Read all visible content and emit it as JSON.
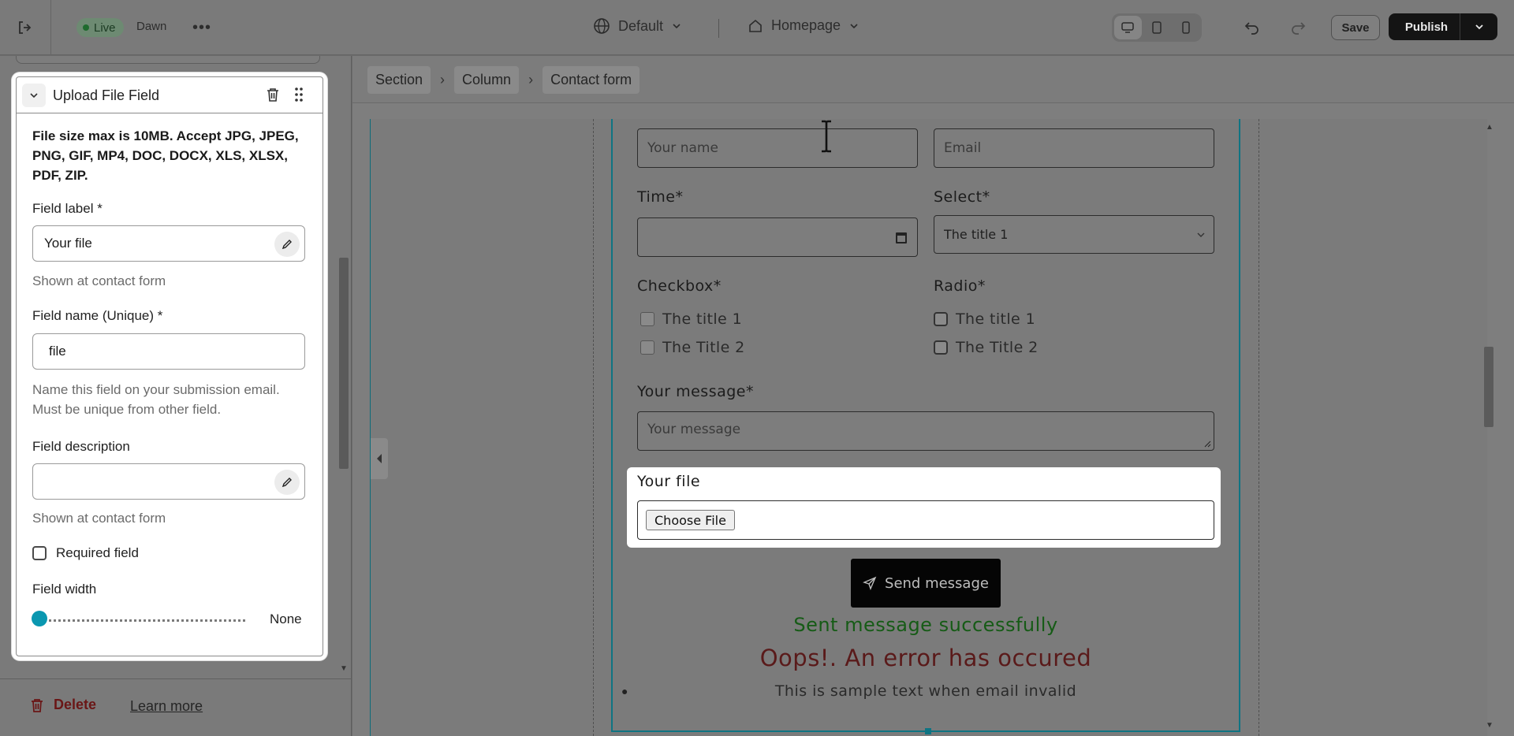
{
  "topbar": {
    "status_badge": "Live",
    "theme_name": "Dawn",
    "more_label": "•••",
    "locale_label": "Default",
    "page_label": "Homepage",
    "save_label": "Save",
    "publish_label": "Publish"
  },
  "sidebar": {
    "panel": {
      "title": "Upload File Field",
      "note": "File size max is 10MB. Accept JPG, JPEG, PNG, GIF, MP4, DOC, DOCX, XLS, XLSX, PDF, ZIP.",
      "field_label_title": "Field label *",
      "field_label_value": "Your file",
      "field_label_help": "Shown at contact form",
      "field_name_title": "Field name (Unique) *",
      "field_name_value": "file",
      "field_name_help": "Name this field on your submission email. Must be unique from other field.",
      "field_desc_title": "Field description",
      "field_desc_value": "",
      "field_desc_help": "Shown at contact form",
      "required_label": "Required field",
      "required_checked": false,
      "width_title": "Field width",
      "width_value": "None",
      "width_fraction": 0.0
    },
    "delete_label": "Delete",
    "learn_more_label": "Learn more"
  },
  "breadcrumb": [
    "Section",
    "Column",
    "Contact form"
  ],
  "preview": {
    "name_placeholder": "Your name",
    "email_placeholder": "Email",
    "time_label": "Time*",
    "select_label": "Select*",
    "select_value": "The title 1",
    "checkbox_label": "Checkbox*",
    "checkbox_options": [
      "The title 1",
      "The Title 2"
    ],
    "radio_label": "Radio*",
    "radio_options": [
      "The title 1",
      "The Title 2"
    ],
    "message_label": "Your message*",
    "message_placeholder": "Your message",
    "file_label": "Your file",
    "choose_file_label": "Choose File",
    "send_label": "Send message",
    "success_text": "Sent message successfully",
    "error_text": "Oops!. An error has occured",
    "sample_text": "This is sample text when email invalid"
  },
  "colors": {
    "accent": "#0a97b0",
    "success": "#165b16",
    "error": "#5a1a1a",
    "publish_bg": "#141414"
  }
}
